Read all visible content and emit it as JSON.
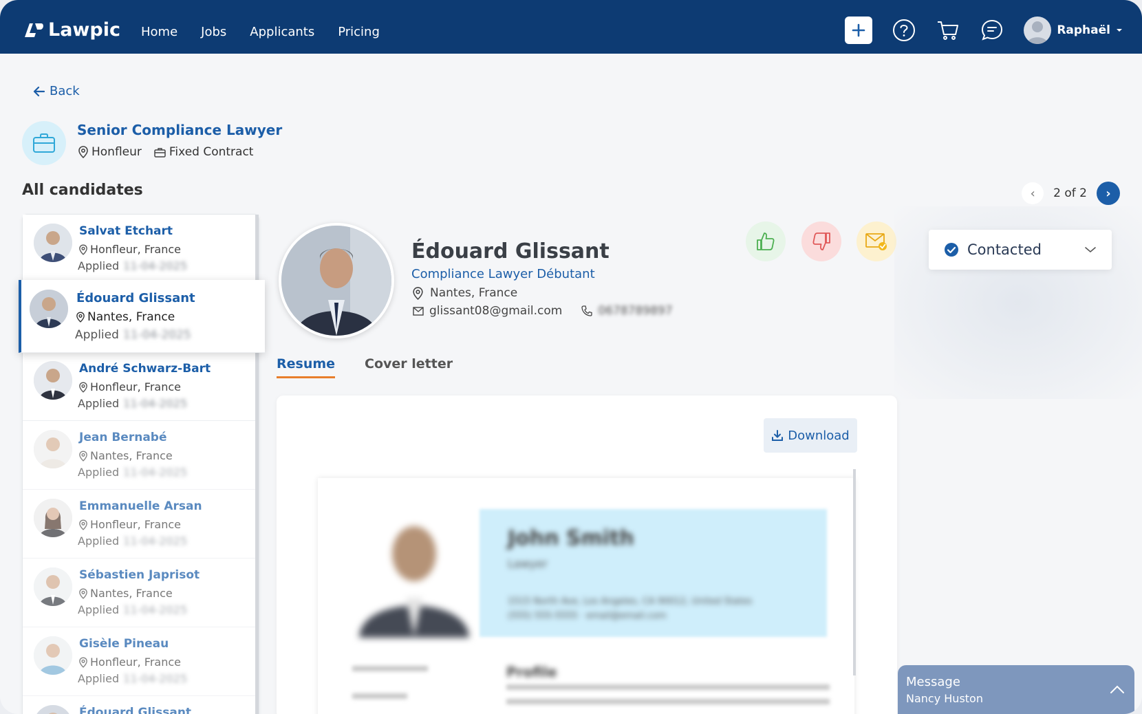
{
  "nav": {
    "brand": "Lawpic",
    "links": [
      "Home",
      "Jobs",
      "Applicants",
      "Pricing"
    ],
    "user": "Raphaël"
  },
  "page": {
    "back": "Back",
    "job_title": "Senior Compliance Lawyer",
    "job_location": "Honfleur",
    "job_contract": "Fixed Contract",
    "list_heading": "All candidates",
    "pager": "2 of 2"
  },
  "candidates": [
    {
      "name": "Salvat Etchart",
      "location": "Honfleur, France",
      "applied_label": "Applied",
      "date": "11-04-2025"
    },
    {
      "name": "Édouard Glissant",
      "location": "Nantes, France",
      "applied_label": "Applied",
      "date": "11-04-2025"
    },
    {
      "name": "André Schwarz-Bart",
      "location": "Honfleur, France",
      "applied_label": "Applied",
      "date": "11-04-2025"
    },
    {
      "name": "Jean Bernabé",
      "location": "Nantes, France",
      "applied_label": "Applied",
      "date": "11-04-2025"
    },
    {
      "name": "Emmanuelle Arsan",
      "location": "Honfleur, France",
      "applied_label": "Applied",
      "date": "11-04-2025"
    },
    {
      "name": "Sébastien Japrisot",
      "location": "Nantes, France",
      "applied_label": "Applied",
      "date": "11-04-2025"
    },
    {
      "name": "Gisèle Pineau",
      "location": "Honfleur, France",
      "applied_label": "Applied",
      "date": "11-04-2025"
    },
    {
      "name": "Édouard Glissant",
      "location": "",
      "applied_label": "",
      "date": ""
    }
  ],
  "profile": {
    "name": "Édouard Glissant",
    "role": "Compliance Lawyer Débutant",
    "location": "Nantes, France",
    "email": "glissant08@gmail.com",
    "phone": "0678789897",
    "status": "Contacted"
  },
  "tabs": [
    "Resume",
    "Cover letter"
  ],
  "resume": {
    "download": "Download",
    "doc_name": "John Smith",
    "doc_role": "Lawyer",
    "doc_address": "1515 North Ave, Los Angeles, CA 90012, United States",
    "doc_contact": "(555) 555-5555 · email@email.com",
    "doc_section": "Profile"
  },
  "message": {
    "title": "Message",
    "contact": "Nancy Huston"
  },
  "colors": {
    "nav_bg": "#0d3b73",
    "accent": "#1c5ea8",
    "tab_underline": "#e87e2c"
  }
}
